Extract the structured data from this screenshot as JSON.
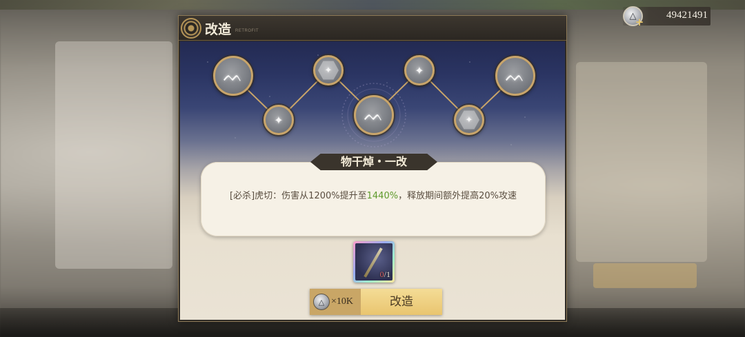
{
  "currency": {
    "icon": "silver-coin-icon",
    "amount": "49421491",
    "add_icon": "plus-icon"
  },
  "close": {
    "icon": "close-icon",
    "glyph": "×"
  },
  "dialog": {
    "title": "改造",
    "subtitle": "RETROFIT",
    "emblem_icon": "retrofit-emblem-icon"
  },
  "tree": {
    "nodes": [
      {
        "name": "skill-upgrade-node",
        "icon": "flame-claw-icon",
        "glyph": "ᨓ"
      },
      {
        "name": "speed-node",
        "icon": "swirl-icon",
        "glyph": "✦"
      },
      {
        "name": "stat-node",
        "icon": "hexagon-star-icon",
        "glyph": "✦"
      },
      {
        "name": "skill-upgrade-node",
        "icon": "flame-claw-icon",
        "glyph": "ᨓ"
      },
      {
        "name": "speed-node",
        "icon": "swirl-icon",
        "glyph": "✦"
      },
      {
        "name": "stat-node",
        "icon": "hexagon-star-icon",
        "glyph": "✦"
      },
      {
        "name": "skill-upgrade-node",
        "icon": "flame-claw-icon",
        "glyph": "ᨓ"
      }
    ]
  },
  "upgrade": {
    "name": "物干焯・一改",
    "description_part1": "[必杀]虎切：伤害从1200%提升至",
    "description_highlight": "1440%",
    "description_part2": "，释放期间额外提高20%攻速",
    "highlight_color": "#5e9a2c"
  },
  "material": {
    "icon": "sword-material-icon",
    "owned": "0",
    "required": "/1"
  },
  "action": {
    "cost_icon": "silver-coin-icon",
    "cost": "×10K",
    "label": "改造"
  },
  "colors": {
    "accent_gold": "#c9a25e",
    "button": "#e9c56f"
  }
}
